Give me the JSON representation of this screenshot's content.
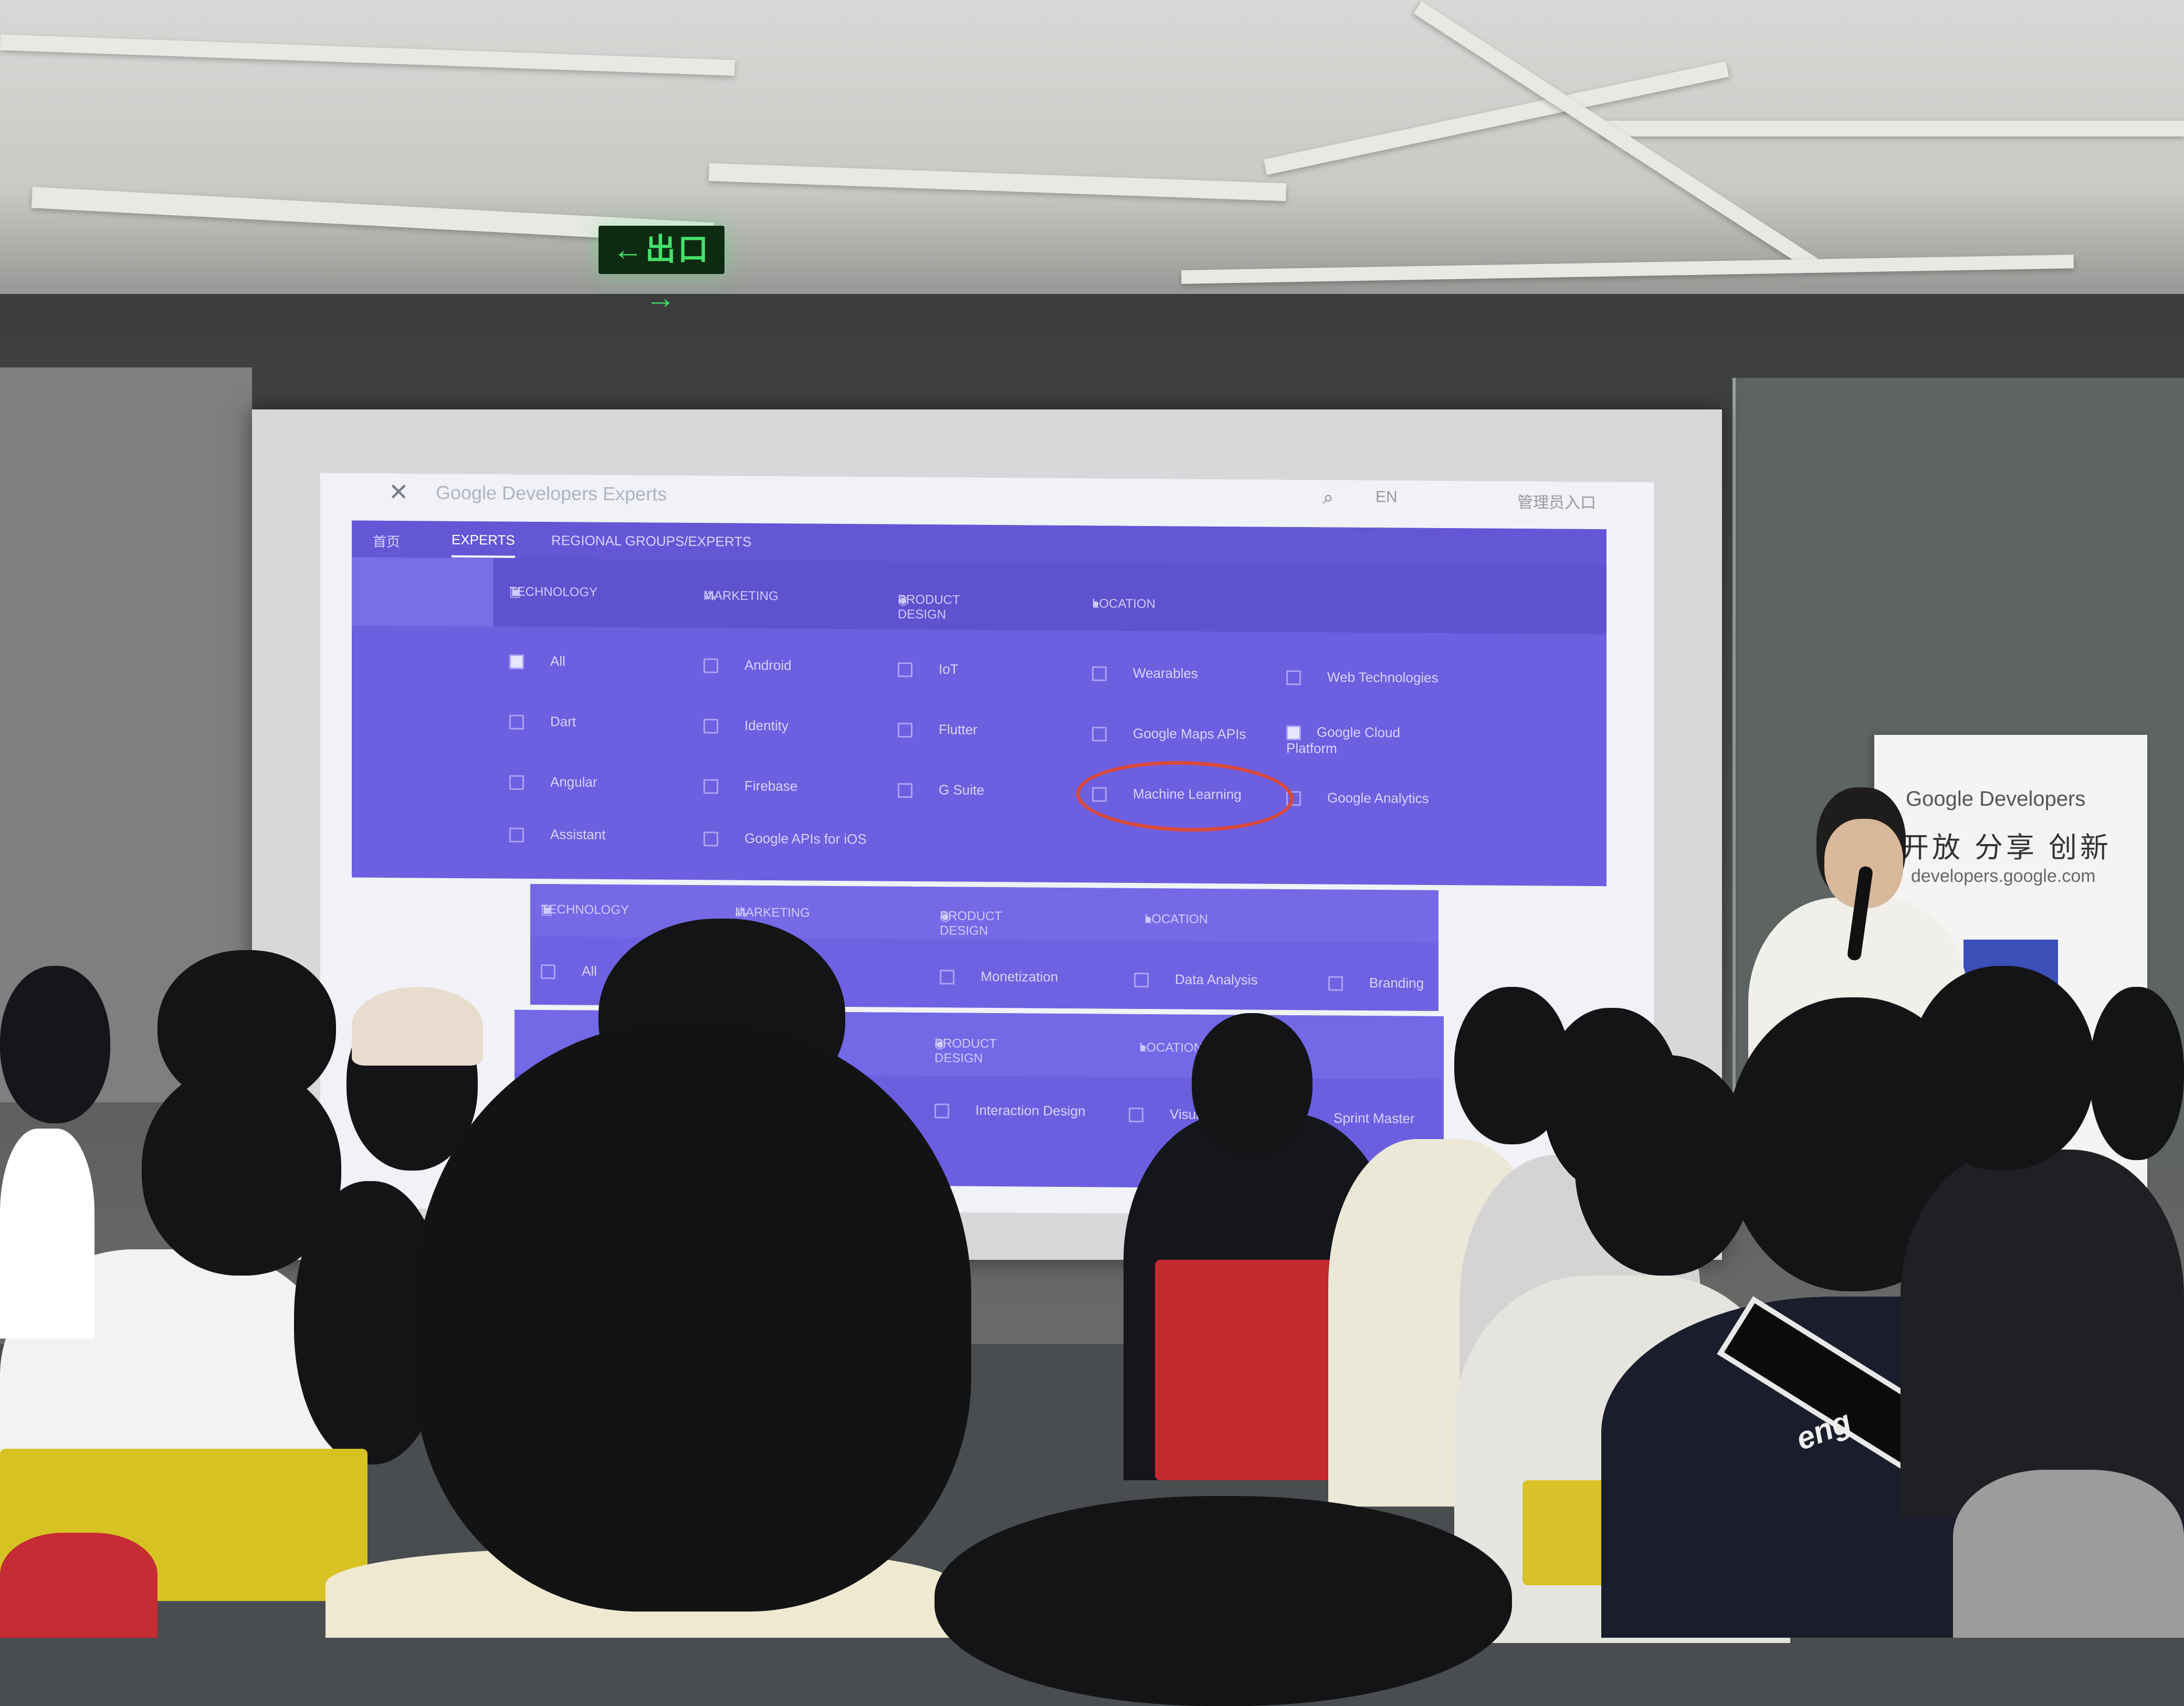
{
  "exit_sign": {
    "text": "←出口→"
  },
  "slide": {
    "site_title": "Google Developers Experts",
    "header_right": "EN",
    "header_corner": "管理员入口",
    "panel1": {
      "tabs": [
        "首页",
        "EXPERTS",
        "REGIONAL GROUPS/EXPERTS"
      ],
      "categories": [
        "TECHNOLOGY",
        "MARKETING",
        "PRODUCT DESIGN",
        "LOCATION"
      ],
      "options": [
        [
          "All",
          "Android",
          "IoT",
          "Wearables",
          "Web Technologies"
        ],
        [
          "Dart",
          "Identity",
          "Flutter",
          "Google Maps APIs",
          "Google Cloud Platform"
        ],
        [
          "Angular",
          "Firebase",
          "G Suite",
          "Machine Learning",
          "Google Analytics"
        ],
        [
          "Assistant",
          "Google APIs for iOS"
        ]
      ]
    },
    "panel2": {
      "categories": [
        "TECHNOLOGY",
        "MARKETING",
        "PRODUCT DESIGN",
        "LOCATION"
      ],
      "options": [
        "All",
        "",
        "Monetization",
        "Data Analysis",
        "Branding"
      ]
    },
    "panel3": {
      "categories": [
        "",
        "",
        "PRODUCT DESIGN",
        "LOCATION"
      ],
      "options": [
        "Interaction Design",
        "Visual",
        "Sprint Master"
      ]
    }
  },
  "banner": {
    "brand": "Google Developers",
    "slogan": "开放 分享 创新",
    "url": "developers.google.com"
  },
  "shirt_text": "eng"
}
